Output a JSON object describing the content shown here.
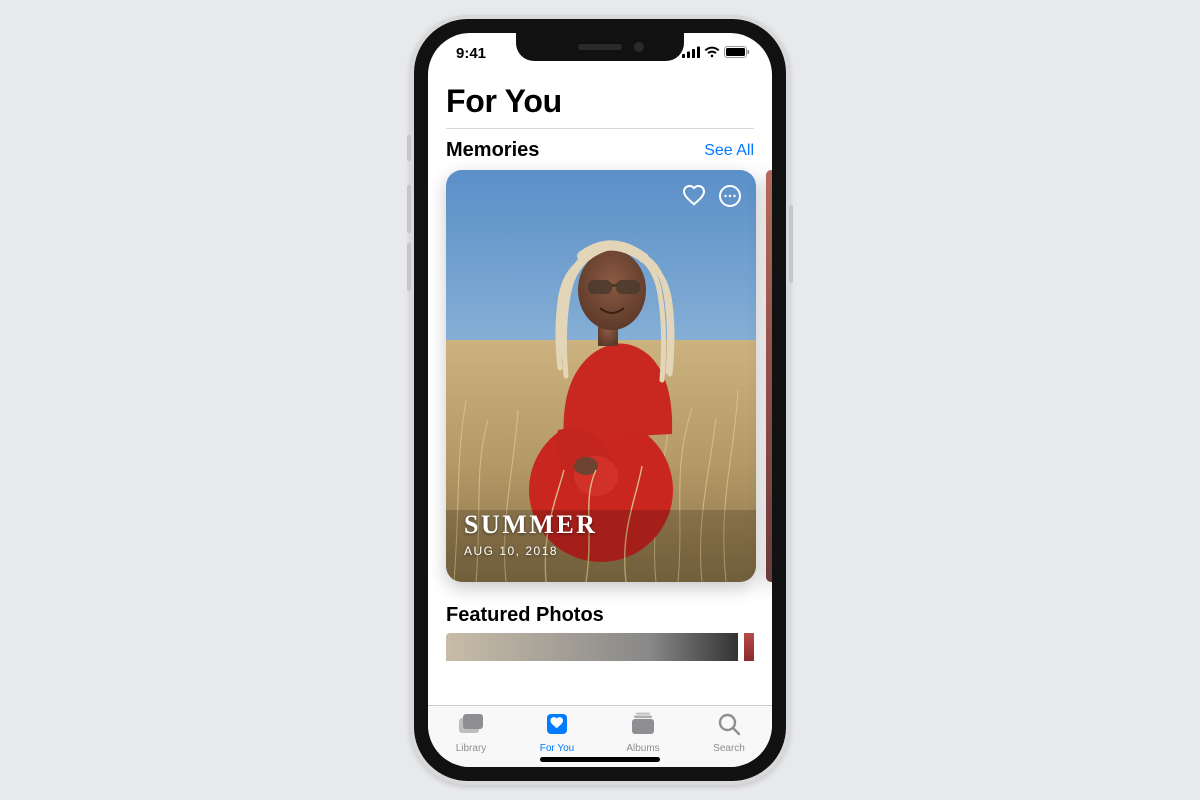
{
  "status_bar": {
    "time": "9:41"
  },
  "page": {
    "title": "For You"
  },
  "memories": {
    "section_title": "Memories",
    "see_all": "See All",
    "card": {
      "title": "SUMMER",
      "date": "AUG 10, 2018"
    }
  },
  "featured": {
    "section_title": "Featured Photos"
  },
  "tabs": {
    "library": "Library",
    "for_you": "For You",
    "albums": "Albums",
    "search": "Search"
  },
  "colors": {
    "accent": "#007aff"
  }
}
